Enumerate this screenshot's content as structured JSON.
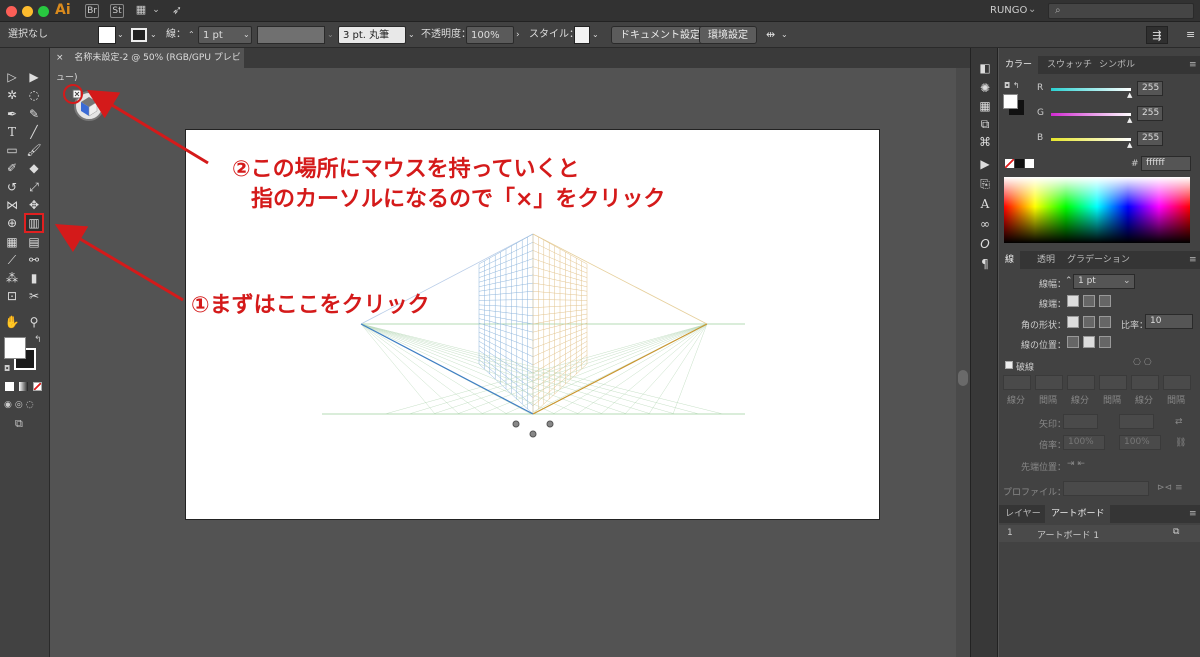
{
  "appbar": {
    "app_logo": "Ai",
    "bridge_label": "Br",
    "stock_label": "St",
    "user_name": "RUNGO",
    "search_placeholder": "⌕"
  },
  "control_bar": {
    "selection_status": "選択なし",
    "stroke_label": "線：",
    "stroke_weight": "1 pt",
    "brush_profile": "3 pt. 丸筆",
    "opacity_label": "不透明度：",
    "opacity_value": "100%",
    "style_label": "スタイル：",
    "document_setup_button": "ドキュメント設定",
    "preferences_button": "環境設定"
  },
  "document_tab": {
    "close_label": "×",
    "title": "名称未設定-2 @ 50% (RGB/GPU プレビュー)"
  },
  "annotations": {
    "step2_line1": "②この場所にマウスを持っていくと",
    "step2_line2": "指のカーソルになるので「×」をクリック",
    "step1": "①まずはここをクリック"
  },
  "color_panel": {
    "tabs": [
      "カラー",
      "スウォッチ",
      "シンボル"
    ],
    "channels": [
      {
        "label": "R",
        "value": "255",
        "color": "#2ad1d1"
      },
      {
        "label": "G",
        "value": "255",
        "color": "#d12ad1"
      },
      {
        "label": "B",
        "value": "255",
        "color": "#e6e62a"
      }
    ],
    "hex_label": "#",
    "hex_value": "ffffff"
  },
  "stroke_panel": {
    "tabs": [
      "線",
      "透明",
      "グラデーション"
    ],
    "weight_label": "線幅：",
    "weight_value": "1 pt",
    "cap_label": "線端：",
    "join_label": "角の形状：",
    "limit_label": "比率：",
    "limit_value": "10",
    "align_label": "線の位置：",
    "dashed_label": "破線",
    "dash_fields": [
      "線分",
      "間隔",
      "線分",
      "間隔",
      "線分",
      "間隔"
    ],
    "arrow_label": "矢印：",
    "scale_label": "倍率：",
    "scale_value_1": "100%",
    "scale_value_2": "100%",
    "align_tip_label": "先端位置：",
    "profile_label": "プロファイル："
  },
  "layers_panel": {
    "tabs": [
      "レイヤー",
      "アートボード"
    ],
    "rows": [
      {
        "index": "1",
        "name": "アートボード 1"
      }
    ]
  }
}
